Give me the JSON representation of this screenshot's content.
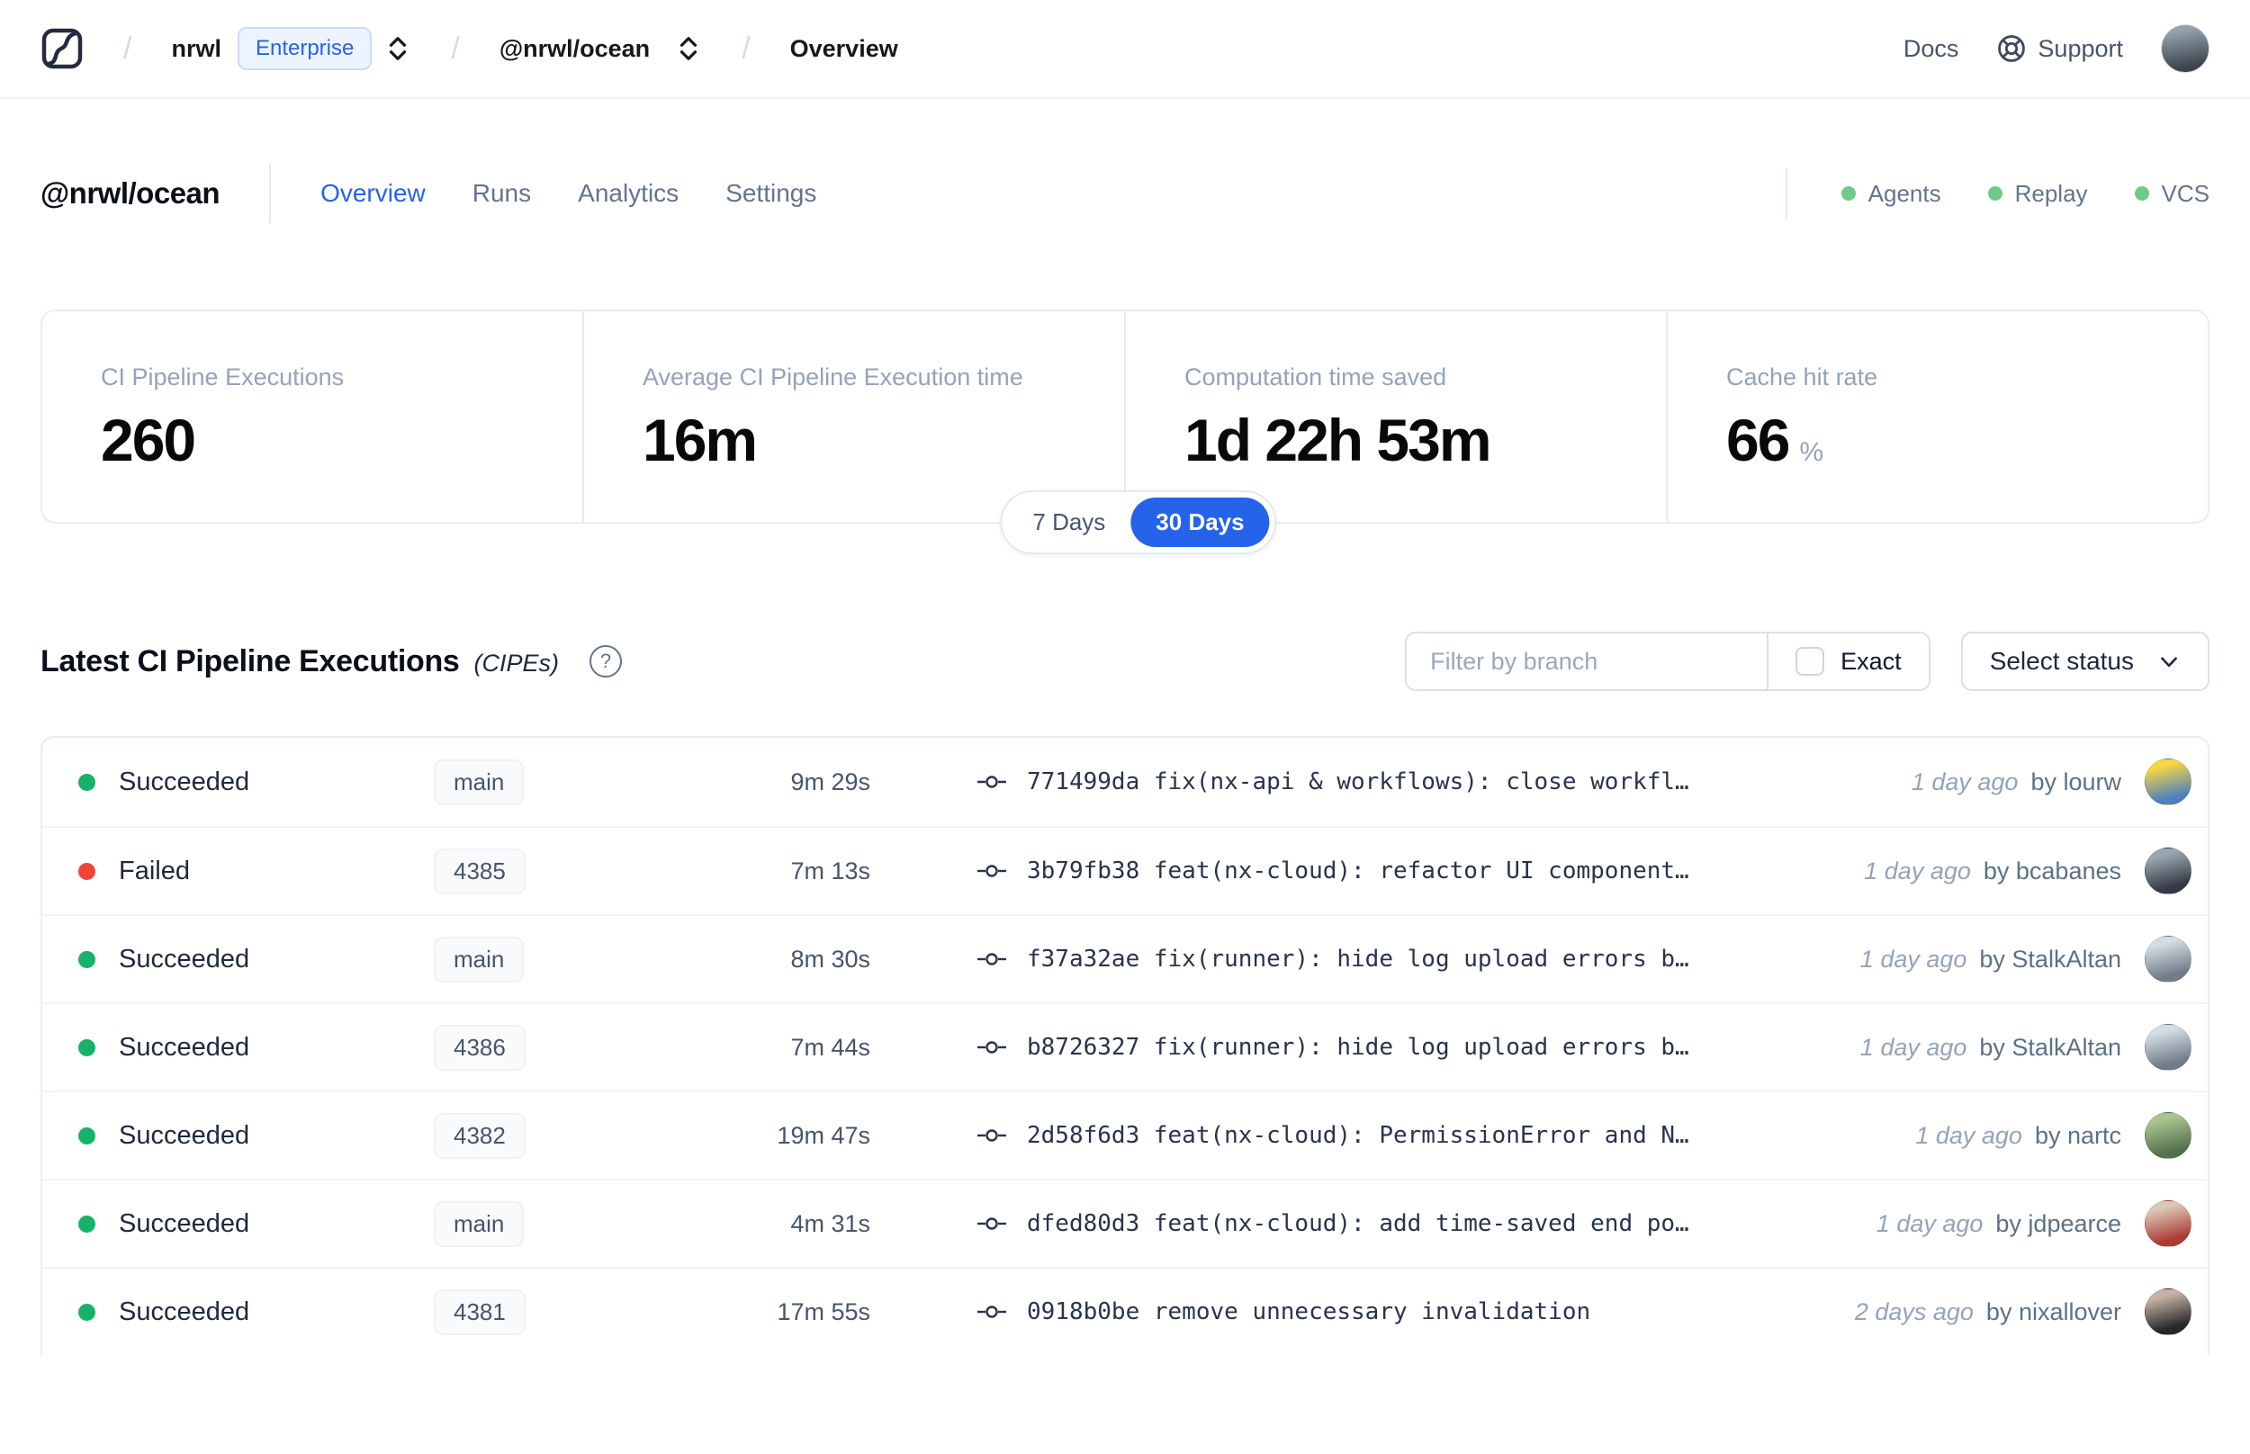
{
  "navbar": {
    "breadcrumb": {
      "org": "nrwl",
      "org_badge": "Enterprise",
      "workspace": "@nrwl/ocean",
      "page": "Overview",
      "separator": "/"
    },
    "links": {
      "docs": "Docs",
      "support": "Support"
    },
    "avatar": {
      "from": "#93a3ae",
      "to": "#3c434d"
    }
  },
  "header": {
    "workspace": "@nrwl/ocean",
    "tabs": [
      {
        "label": "Overview",
        "active": true
      },
      {
        "label": "Runs",
        "active": false
      },
      {
        "label": "Analytics",
        "active": false
      },
      {
        "label": "Settings",
        "active": false
      }
    ],
    "indicators": [
      {
        "label": "Agents"
      },
      {
        "label": "Replay"
      },
      {
        "label": "VCS"
      }
    ]
  },
  "stats": {
    "cards": [
      {
        "label": "CI Pipeline Executions",
        "value": "260",
        "suffix": ""
      },
      {
        "label": "Average CI Pipeline Execution time",
        "value": "16m",
        "suffix": ""
      },
      {
        "label": "Computation time saved",
        "value": "1d 22h 53m",
        "suffix": ""
      },
      {
        "label": "Cache hit rate",
        "value": "66",
        "suffix": "%"
      }
    ],
    "range_toggle": {
      "options": [
        "7 Days",
        "30 Days"
      ],
      "selected": "30 Days"
    }
  },
  "cipes": {
    "title": "Latest CI Pipeline Executions",
    "title_suffix": "(CIPEs)",
    "help_glyph": "?",
    "filter_placeholder": "Filter by branch",
    "exact_label": "Exact",
    "status_select_label": "Select status",
    "rows": [
      {
        "status": "Succeeded",
        "status_color": "#17b26a",
        "branch": "main",
        "duration": "9m 29s",
        "commit": "771499da fix(nx-api & workflows): close workfl…",
        "time_ago": "1 day ago",
        "author": "by lourw",
        "avatar": {
          "from": "#f6d644",
          "to": "#4e7fc0"
        }
      },
      {
        "status": "Failed",
        "status_color": "#f04438",
        "branch": "4385",
        "duration": "7m 13s",
        "commit": "3b79fb38 feat(nx-cloud): refactor UI component…",
        "time_ago": "1 day ago",
        "author": "by bcabanes",
        "avatar": {
          "from": "#9aa7b0",
          "to": "#343a45"
        }
      },
      {
        "status": "Succeeded",
        "status_color": "#17b26a",
        "branch": "main",
        "duration": "8m 30s",
        "commit": "f37a32ae fix(runner): hide log upload errors b…",
        "time_ago": "1 day ago",
        "author": "by StalkAltan",
        "avatar": {
          "from": "#d4dde3",
          "to": "#707c8a"
        }
      },
      {
        "status": "Succeeded",
        "status_color": "#17b26a",
        "branch": "4386",
        "duration": "7m 44s",
        "commit": "b8726327 fix(runner): hide log upload errors b…",
        "time_ago": "1 day ago",
        "author": "by StalkAltan",
        "avatar": {
          "from": "#d4dde3",
          "to": "#707c8a"
        }
      },
      {
        "status": "Succeeded",
        "status_color": "#17b26a",
        "branch": "4382",
        "duration": "19m 47s",
        "commit": "2d58f6d3 feat(nx-cloud): PermissionError and N…",
        "time_ago": "1 day ago",
        "author": "by nartc",
        "avatar": {
          "from": "#a9c48e",
          "to": "#55704f"
        }
      },
      {
        "status": "Succeeded",
        "status_color": "#17b26a",
        "branch": "main",
        "duration": "4m 31s",
        "commit": "dfed80d3 feat(nx-cloud): add time-saved end po…",
        "time_ago": "1 day ago",
        "author": "by jdpearce",
        "avatar": {
          "from": "#d9c8b6",
          "to": "#ad3a35"
        }
      },
      {
        "status": "Succeeded",
        "status_color": "#17b26a",
        "branch": "4381",
        "duration": "17m 55s",
        "commit": "0918b0be remove unnecessary invalidation",
        "time_ago": "2 days ago",
        "author": "by nixallover",
        "avatar": {
          "from": "#c7b3a4",
          "to": "#26262b"
        }
      }
    ]
  },
  "colors": {
    "accent_blue": "#2563eb",
    "indicator_green": "#6ecb87",
    "succeeded_green": "#17b26a",
    "failed_red": "#f04438"
  }
}
